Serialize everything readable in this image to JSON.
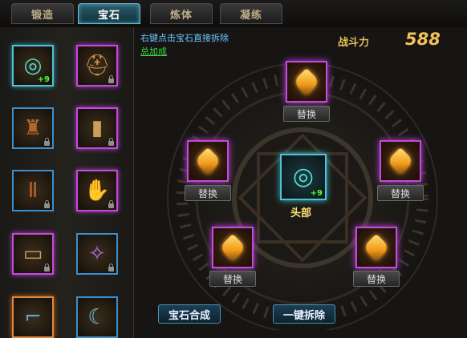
{
  "tabs": [
    {
      "label": "锻造",
      "active": false
    },
    {
      "label": "宝石",
      "active": true
    },
    {
      "label": "炼体",
      "active": false
    },
    {
      "label": "凝练",
      "active": false
    }
  ],
  "equipment_slots": [
    {
      "name": "necklace",
      "icon": "necklace-icon",
      "frame": "teal",
      "badge": "+9",
      "locked": false
    },
    {
      "name": "helmet",
      "icon": "helmet-icon",
      "frame": "purple",
      "badge": "",
      "locked": true
    },
    {
      "name": "armor",
      "icon": "armor-icon",
      "frame": "blue",
      "badge": "",
      "locked": true
    },
    {
      "name": "bracer",
      "icon": "bracer-icon",
      "frame": "purple",
      "badge": "",
      "locked": true
    },
    {
      "name": "pants",
      "icon": "pants-icon",
      "frame": "blue",
      "badge": "",
      "locked": true
    },
    {
      "name": "gloves",
      "icon": "gloves-icon",
      "frame": "purple",
      "badge": "",
      "locked": true
    },
    {
      "name": "belt",
      "icon": "belt-icon",
      "frame": "purple",
      "badge": "",
      "locked": true
    },
    {
      "name": "amulet",
      "icon": "amulet-icon",
      "frame": "blue",
      "badge": "",
      "locked": true
    },
    {
      "name": "boots",
      "icon": "boots-icon",
      "frame": "orange",
      "badge": "",
      "locked": false
    },
    {
      "name": "weapon",
      "icon": "weapon-icon",
      "frame": "blue",
      "badge": "",
      "locked": false
    }
  ],
  "main": {
    "hint": "右键点击宝石直接拆除",
    "bonus_link": "总加成",
    "power_label": "战斗力",
    "power_value": "588",
    "center_slot": {
      "label": "头部",
      "badge": "+9",
      "icon": "necklace-icon"
    },
    "gem_slots": [
      {
        "position": "top",
        "icon": "amber-gem-icon",
        "button": "替换"
      },
      {
        "position": "left",
        "icon": "amber-gem-icon",
        "button": "替换"
      },
      {
        "position": "right",
        "icon": "amber-gem-icon",
        "button": "替换"
      },
      {
        "position": "bottom-left",
        "icon": "amber-gem-icon",
        "button": "替换"
      },
      {
        "position": "bottom-right",
        "icon": "amber-gem-icon",
        "button": "替换"
      }
    ],
    "compose_button": "宝石合成",
    "remove_all_button": "一键拆除"
  },
  "colors": {
    "purple_frame": "#c44ad9",
    "blue_frame": "#3b8fd0",
    "teal_frame": "#4cc3d6",
    "hint_text": "#6ec6ff",
    "bonus_text": "#3edc3e",
    "power_text": "#f3c35a"
  }
}
